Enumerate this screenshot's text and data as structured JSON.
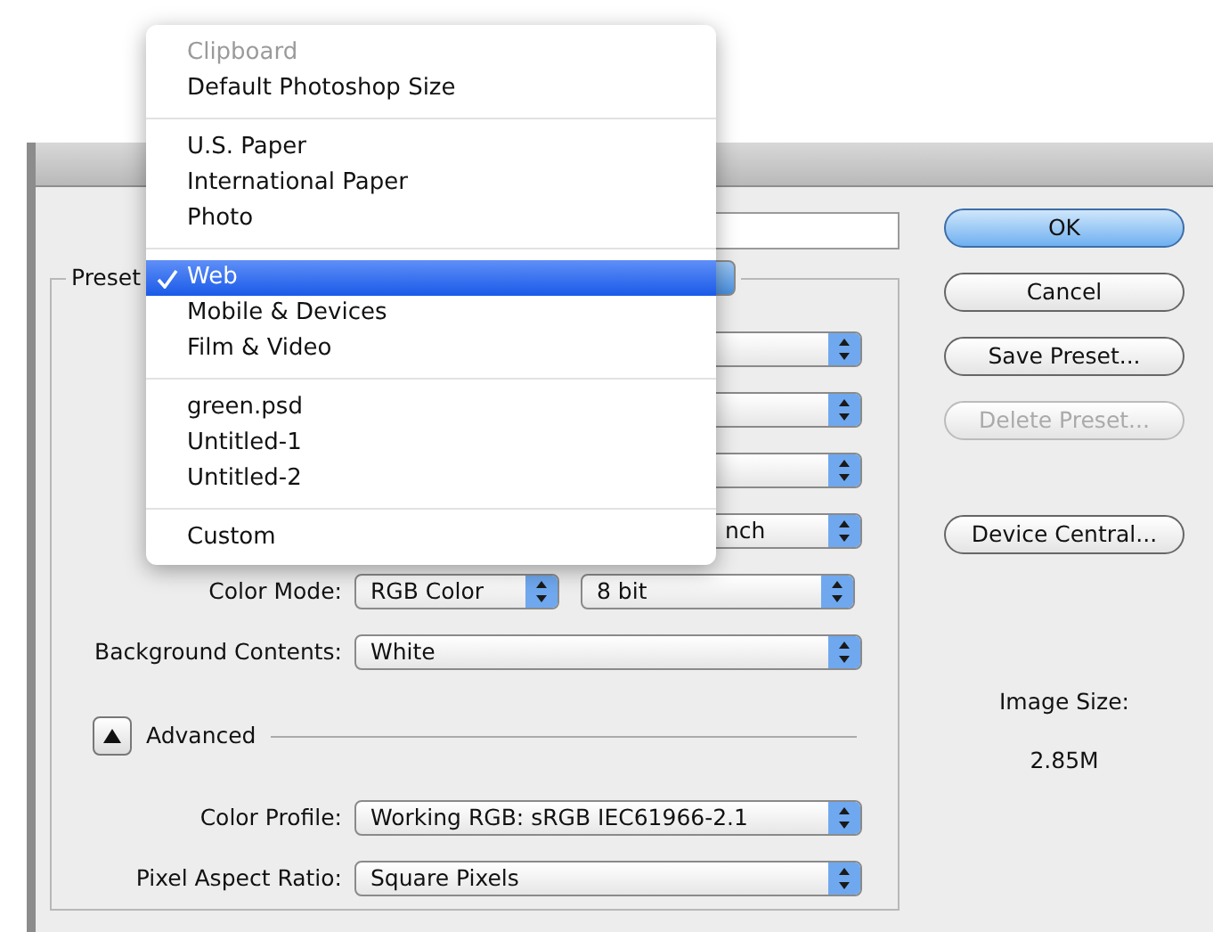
{
  "menu": {
    "groups": [
      {
        "items": [
          {
            "label": "Clipboard",
            "disabled": true,
            "selected": false
          },
          {
            "label": "Default Photoshop Size",
            "disabled": false,
            "selected": false
          }
        ]
      },
      {
        "items": [
          {
            "label": "U.S. Paper",
            "disabled": false,
            "selected": false
          },
          {
            "label": "International Paper",
            "disabled": false,
            "selected": false
          },
          {
            "label": "Photo",
            "disabled": false,
            "selected": false
          }
        ]
      },
      {
        "items": [
          {
            "label": "Web",
            "disabled": false,
            "selected": true
          },
          {
            "label": "Mobile & Devices",
            "disabled": false,
            "selected": false
          },
          {
            "label": "Film & Video",
            "disabled": false,
            "selected": false
          }
        ]
      },
      {
        "items": [
          {
            "label": "green.psd",
            "disabled": false,
            "selected": false
          },
          {
            "label": "Untitled-1",
            "disabled": false,
            "selected": false
          },
          {
            "label": "Untitled-2",
            "disabled": false,
            "selected": false
          }
        ]
      },
      {
        "items": [
          {
            "label": "Custom",
            "disabled": false,
            "selected": false
          }
        ]
      }
    ]
  },
  "preset": {
    "label": "Preset"
  },
  "covered_rows": [
    {
      "kind": "wide"
    },
    {
      "kind": "pair"
    },
    {
      "kind": "pair"
    },
    {
      "kind": "pair",
      "unit": "nch"
    }
  ],
  "color_mode": {
    "label": "Color Mode:",
    "value": "RGB Color",
    "depth": "8 bit"
  },
  "background_contents": {
    "label": "Background Contents:",
    "value": "White"
  },
  "advanced": {
    "label": "Advanced",
    "expanded": true
  },
  "advanced_fields": [
    {
      "label": "Color Profile:",
      "value": "Working RGB:  sRGB IEC61966-2.1"
    },
    {
      "label": "Pixel Aspect Ratio:",
      "value": "Square Pixels"
    }
  ],
  "buttons": [
    {
      "label": "OK",
      "kind": "default",
      "disabled": false
    },
    {
      "label": "Cancel",
      "kind": "normal",
      "disabled": false
    },
    {
      "label": "Save Preset...",
      "kind": "normal",
      "disabled": false
    },
    {
      "label": "Delete Preset...",
      "kind": "normal",
      "disabled": true
    },
    {
      "label": "Device Central...",
      "kind": "spaced",
      "disabled": false
    }
  ],
  "image_size": {
    "label": "Image Size:",
    "value": "2.85M"
  }
}
